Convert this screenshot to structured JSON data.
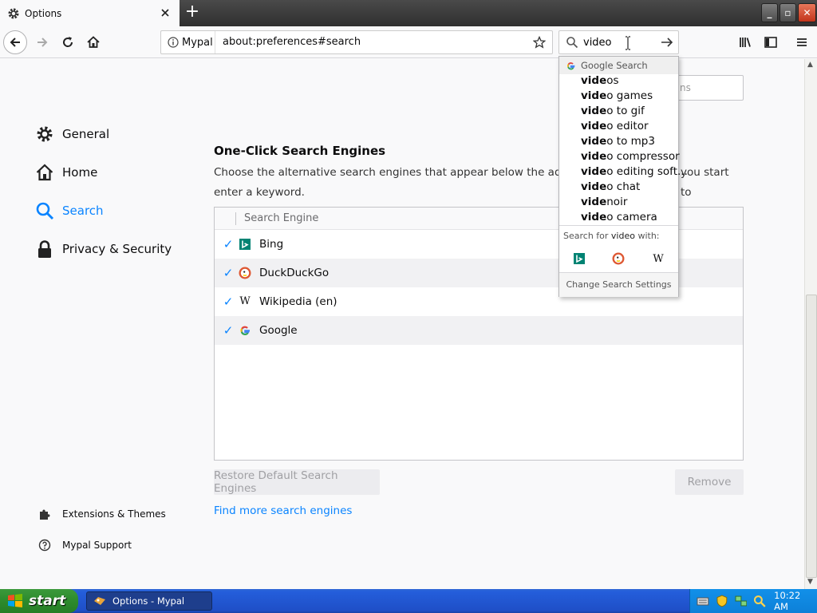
{
  "window": {
    "tab_title": "Options",
    "new_tab_glyph": "+"
  },
  "navbar": {
    "identity_label": "Mypal",
    "url": "about:preferences#search",
    "search_value": "video"
  },
  "sidebar": {
    "categories": [
      {
        "label": "General",
        "icon": "gear-icon"
      },
      {
        "label": "Home",
        "icon": "home-icon"
      },
      {
        "label": "Search",
        "icon": "search-icon",
        "selected": true
      },
      {
        "label": "Privacy & Security",
        "icon": "lock-icon"
      }
    ],
    "footer": [
      {
        "label": "Extensions & Themes",
        "icon": "puzzle-icon"
      },
      {
        "label": "Mypal Support",
        "icon": "help-icon"
      }
    ]
  },
  "main": {
    "find_placeholder_fragment": "ns",
    "section_title": "One-Click Search Engines",
    "section_desc_line1": "Choose the alternative search engines that appear below the address b",
    "section_desc_line1_tail": "you start to",
    "section_desc_line2": "enter a keyword.",
    "engines_header": "Search Engine",
    "engines": [
      {
        "name": "Bing",
        "checked": true,
        "icon": "bing-icon"
      },
      {
        "name": "DuckDuckGo",
        "checked": true,
        "icon": "duckduckgo-icon"
      },
      {
        "name": "Wikipedia (en)",
        "checked": true,
        "icon": "wikipedia-icon"
      },
      {
        "name": "Google",
        "checked": true,
        "icon": "google-icon"
      }
    ],
    "restore_button": "Restore Default Search Engines",
    "remove_button": "Remove",
    "find_more_link": "Find more search engines"
  },
  "dropdown": {
    "header": "Google Search",
    "suggestions": [
      {
        "bold": "vide",
        "rest": "os"
      },
      {
        "bold": "vide",
        "rest": "o games"
      },
      {
        "bold": "vide",
        "rest": "o to gif"
      },
      {
        "bold": "vide",
        "rest": "o editor"
      },
      {
        "bold": "vide",
        "rest": "o to mp3"
      },
      {
        "bold": "vide",
        "rest": "o compressor"
      },
      {
        "bold": "vide",
        "rest": "o editing soft..."
      },
      {
        "bold": "vide",
        "rest": "o chat"
      },
      {
        "bold": "vide",
        "rest": "noir"
      },
      {
        "bold": "vide",
        "rest": "o camera"
      }
    ],
    "search_with_prefix": "Search for ",
    "search_with_term": "video",
    "search_with_suffix": " with:",
    "change_settings": "Change Search Settings",
    "wiki_glyph": "W"
  },
  "taskbar": {
    "start_label": "start",
    "task_label": "Options - Mypal",
    "clock": "10:22 AM"
  },
  "colors": {
    "accent": "#0a84ff",
    "start_green": "#2f8d2f",
    "taskbar_blue": "#245edb"
  }
}
